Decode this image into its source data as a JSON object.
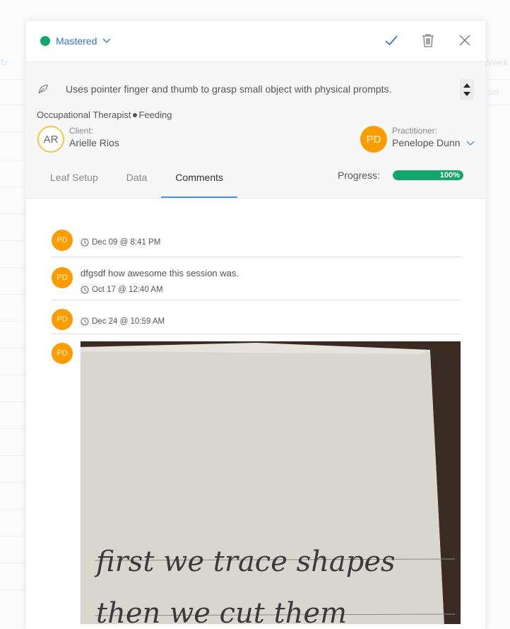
{
  "background": {
    "week_label": "Week",
    "day_label": "Sat"
  },
  "status": {
    "label": "Mastered",
    "color": "#13a66b"
  },
  "goal": {
    "text": "Uses pointer finger and thumb to grasp small object with physical prompts."
  },
  "category": {
    "discipline": "Occupational Therapist",
    "area": "Feeding"
  },
  "client": {
    "role": "Client:",
    "initials": "AR",
    "name": "Arielle Rios"
  },
  "practitioner": {
    "role": "Practitioner:",
    "initials": "PD",
    "name": "Penelope Dunn"
  },
  "tabs": [
    {
      "label": "Leaf Setup",
      "active": false
    },
    {
      "label": "Data",
      "active": false
    },
    {
      "label": "Comments",
      "active": true
    }
  ],
  "progress": {
    "label": "Progress:",
    "value": 100,
    "text": "100%",
    "color": "#13a66b"
  },
  "comments": [
    {
      "initials": "PD",
      "text": "",
      "timestamp": "Dec 09 @ 8:41 PM"
    },
    {
      "initials": "PD",
      "text": "dfgsdf how awesome this session was.",
      "timestamp": "Oct 17 @ 12:40 AM"
    },
    {
      "initials": "PD",
      "text": "",
      "timestamp": "Dec 24 @ 10:59 AM"
    },
    {
      "initials": "PD",
      "attachment": "handwriting-photo",
      "handwriting_line1": "first we trace shapes",
      "handwriting_line2": "then we cut them"
    }
  ],
  "colors": {
    "accent": "#4a90e2",
    "avatar": "#fb9c00",
    "avatar_outline": "#f6c443"
  }
}
